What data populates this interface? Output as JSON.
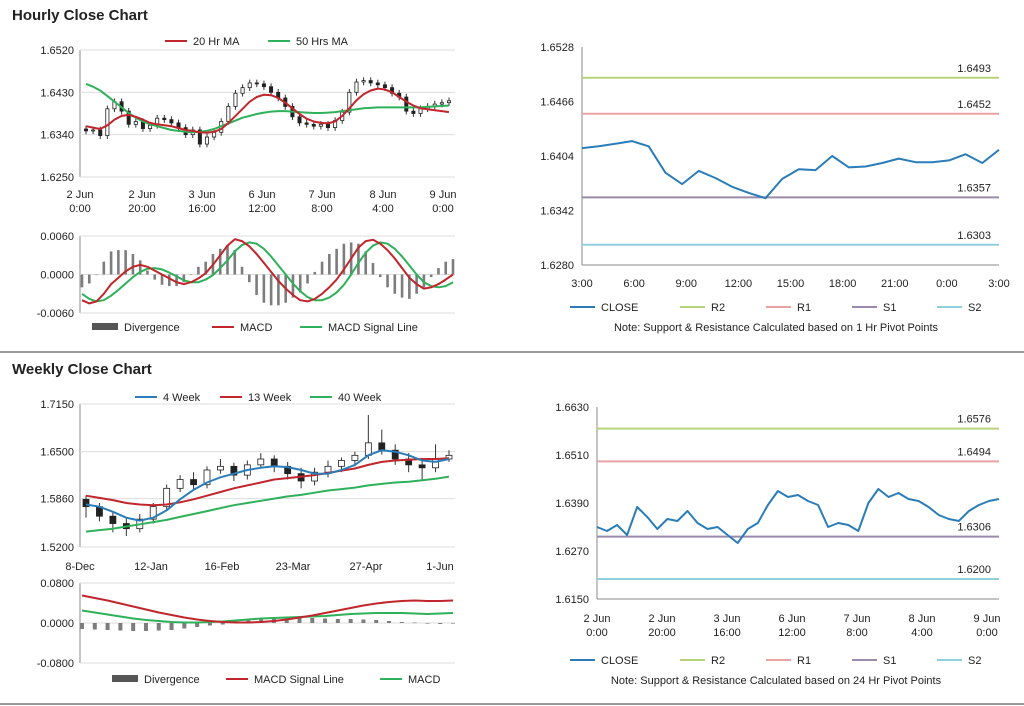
{
  "sections": {
    "hourly_title": "Hourly Close Chart",
    "weekly_title": "Weekly Close Chart"
  },
  "colors": {
    "blue": "#2a7db8",
    "red": "#c0262c",
    "green": "#2fb05a",
    "r2": "#b7d37a",
    "r1": "#e8a3a3",
    "s1": "#9a8aab",
    "s2": "#8fd0e0",
    "divergence": "#7d7d7d"
  },
  "chart_data": [
    {
      "id": "hourly-price",
      "type": "candlestick",
      "legend": [
        "20 Hr MA",
        "50 Hrs MA"
      ],
      "y_ticks": [
        "1.6520",
        "1.6430",
        "1.6340",
        "1.6250"
      ],
      "ylim": [
        1.625,
        1.652
      ],
      "x_ticks": [
        [
          "2 Jun",
          "0:00"
        ],
        [
          "2 Jun",
          "20:00"
        ],
        [
          "3 Jun",
          "16:00"
        ],
        [
          "6 Jun",
          "12:00"
        ],
        [
          "7 Jun",
          "8:00"
        ],
        [
          "8 Jun",
          "4:00"
        ],
        [
          "9 Jun",
          "0:00"
        ]
      ],
      "close": [
        1.6348,
        1.635,
        1.6338,
        1.6395,
        1.641,
        1.639,
        1.6362,
        1.6368,
        1.6353,
        1.636,
        1.6375,
        1.6372,
        1.6365,
        1.6355,
        1.634,
        1.635,
        1.632,
        1.6335,
        1.6345,
        1.6368,
        1.64,
        1.6428,
        1.644,
        1.645,
        1.6448,
        1.6442,
        1.643,
        1.6418,
        1.64,
        1.6378,
        1.6365,
        1.6362,
        1.6358,
        1.6362,
        1.6355,
        1.637,
        1.6388,
        1.643,
        1.6452,
        1.6455,
        1.645,
        1.6446,
        1.644,
        1.6428,
        1.642,
        1.639,
        1.6385,
        1.6395,
        1.64,
        1.6405,
        1.6408,
        1.6412
      ],
      "ma20": [
        1.6358,
        1.6355,
        1.6352,
        1.636,
        1.6372,
        1.638,
        1.6382,
        1.6378,
        1.6372,
        1.6365,
        1.6362,
        1.636,
        1.6358,
        1.6354,
        1.635,
        1.6348,
        1.6345,
        1.6344,
        1.6346,
        1.6352,
        1.6365,
        1.638,
        1.6395,
        1.641,
        1.642,
        1.6425,
        1.6424,
        1.6418,
        1.6408,
        1.6396,
        1.6384,
        1.6374,
        1.6368,
        1.6365,
        1.6364,
        1.6368,
        1.638,
        1.6396,
        1.6413,
        1.6426,
        1.6434,
        1.6438,
        1.6436,
        1.643,
        1.642,
        1.641,
        1.6402,
        1.6396,
        1.6394,
        1.6392,
        1.639,
        1.6388
      ],
      "ma50": [
        1.6448,
        1.6442,
        1.6434,
        1.6422,
        1.641,
        1.6398,
        1.6386,
        1.6376,
        1.6368,
        1.6362,
        1.6358,
        1.6354,
        1.635,
        1.6348,
        1.6346,
        1.6345,
        1.6346,
        1.6348,
        1.6352,
        1.6358,
        1.6364,
        1.637,
        1.6376,
        1.638,
        1.6384,
        1.6387,
        1.6389,
        1.639,
        1.639,
        1.6389,
        1.6388,
        1.6387,
        1.6386,
        1.6386,
        1.6387,
        1.6388,
        1.639,
        1.6392,
        1.6394,
        1.6396,
        1.6397,
        1.6398,
        1.6398,
        1.6398,
        1.6398,
        1.6398,
        1.6398,
        1.6398,
        1.6399,
        1.64,
        1.6401,
        1.6402
      ]
    },
    {
      "id": "hourly-macd",
      "type": "line+bar",
      "legend": [
        "Divergence",
        "MACD",
        "MACD Signal Line"
      ],
      "y_ticks": [
        "0.0060",
        "0.0000",
        "-0.0060"
      ],
      "ylim": [
        -0.006,
        0.006
      ],
      "macd": [
        -0.004,
        -0.0045,
        -0.0042,
        -0.003,
        -0.0015,
        -0.0005,
        0.0005,
        0.0012,
        0.0015,
        0.0012,
        0.0006,
        0.0,
        -0.0006,
        -0.0012,
        -0.0015,
        -0.0012,
        -0.0006,
        0.0002,
        0.0015,
        0.003,
        0.0045,
        0.0055,
        0.0052,
        0.0044,
        0.0032,
        0.0018,
        0.0004,
        -0.001,
        -0.0022,
        -0.0032,
        -0.004,
        -0.0042,
        -0.0038,
        -0.003,
        -0.002,
        -0.0008,
        0.0008,
        0.0025,
        0.0042,
        0.0052,
        0.0054,
        0.0048,
        0.0038,
        0.0025,
        0.001,
        -0.0005,
        -0.0015,
        -0.0022,
        -0.002,
        -0.0015,
        -0.0008,
        0.0
      ],
      "signal": [
        -0.003,
        -0.0038,
        -0.0042,
        -0.004,
        -0.0033,
        -0.0024,
        -0.0014,
        -0.0004,
        0.0004,
        0.0009,
        0.001,
        0.0008,
        0.0003,
        -0.0003,
        -0.0009,
        -0.0012,
        -0.0012,
        -0.0008,
        -0.0001,
        0.001,
        0.0022,
        0.0036,
        0.0046,
        0.005,
        0.0048,
        0.004,
        0.0028,
        0.0014,
        0.0,
        -0.0014,
        -0.0026,
        -0.0035,
        -0.004,
        -0.004,
        -0.0036,
        -0.0028,
        -0.0016,
        0.0,
        0.0018,
        0.0034,
        0.0045,
        0.005,
        0.0048,
        0.004,
        0.0028,
        0.0014,
        0.0,
        -0.0012,
        -0.0018,
        -0.002,
        -0.0018,
        -0.0012
      ]
    },
    {
      "id": "hourly-pivots",
      "type": "line",
      "legend": [
        "CLOSE",
        "R2",
        "R1",
        "S1",
        "S2"
      ],
      "y_ticks": [
        "1.6528",
        "1.6466",
        "1.6404",
        "1.6342",
        "1.6280"
      ],
      "ylim": [
        1.628,
        1.6528
      ],
      "x_ticks": [
        "3:00",
        "6:00",
        "9:00",
        "12:00",
        "15:00",
        "18:00",
        "21:00",
        "0:00",
        "3:00"
      ],
      "x_hours": [
        0,
        1,
        2,
        3,
        4,
        5,
        6,
        7,
        8,
        9,
        10,
        11,
        12,
        13,
        14,
        15,
        16,
        17,
        18,
        19,
        20,
        21,
        22,
        23,
        24
      ],
      "close": [
        1.6413,
        1.6415,
        1.6418,
        1.6421,
        1.6415,
        1.6385,
        1.6372,
        1.6387,
        1.6379,
        1.6369,
        1.6362,
        1.6356,
        1.6378,
        1.6389,
        1.6388,
        1.6404,
        1.6391,
        1.6392,
        1.6396,
        1.6401,
        1.6397,
        1.6397,
        1.6399,
        1.6406,
        1.6396,
        1.6411
      ],
      "levels": {
        "R2": 1.6493,
        "R1": 1.6452,
        "S1": 1.6357,
        "S2": 1.6303
      },
      "level_labels": {
        "R2": "1.6493",
        "R1": "1.6452",
        "S1": "1.6357",
        "S2": "1.6303"
      },
      "note": "Note: Support & Resistance Calculated based on 1 Hr Pivot Points"
    },
    {
      "id": "weekly-price",
      "type": "candlestick",
      "legend": [
        "4 Week",
        "13 Week",
        "40 Week"
      ],
      "y_ticks": [
        "1.7150",
        "1.6500",
        "1.5860",
        "1.5200"
      ],
      "ylim": [
        1.52,
        1.715
      ],
      "x_ticks": [
        "8-Dec",
        "12-Jan",
        "16-Feb",
        "23-Mar",
        "27-Apr",
        "1-Jun"
      ],
      "candles": [
        [
          1.585,
          1.575,
          1.59,
          1.56
        ],
        [
          1.575,
          1.562,
          1.58,
          1.555
        ],
        [
          1.562,
          1.552,
          1.568,
          1.54
        ],
        [
          1.552,
          1.545,
          1.56,
          1.535
        ],
        [
          1.545,
          1.558,
          1.565,
          1.54
        ],
        [
          1.558,
          1.575,
          1.58,
          1.552
        ],
        [
          1.575,
          1.6,
          1.605,
          1.57
        ],
        [
          1.6,
          1.612,
          1.618,
          1.595
        ],
        [
          1.612,
          1.605,
          1.622,
          1.598
        ],
        [
          1.605,
          1.625,
          1.63,
          1.6
        ],
        [
          1.625,
          1.63,
          1.64,
          1.62
        ],
        [
          1.63,
          1.618,
          1.635,
          1.61
        ],
        [
          1.618,
          1.632,
          1.638,
          1.612
        ],
        [
          1.632,
          1.64,
          1.648,
          1.628
        ],
        [
          1.64,
          1.63,
          1.645,
          1.622
        ],
        [
          1.63,
          1.62,
          1.636,
          1.612
        ],
        [
          1.62,
          1.61,
          1.628,
          1.6
        ],
        [
          1.61,
          1.622,
          1.628,
          1.604
        ],
        [
          1.622,
          1.63,
          1.638,
          1.615
        ],
        [
          1.63,
          1.638,
          1.642,
          1.622
        ],
        [
          1.638,
          1.645,
          1.65,
          1.63
        ],
        [
          1.645,
          1.662,
          1.7,
          1.64
        ],
        [
          1.662,
          1.652,
          1.68,
          1.646
        ],
        [
          1.652,
          1.64,
          1.66,
          1.632
        ],
        [
          1.64,
          1.632,
          1.648,
          1.622
        ],
        [
          1.632,
          1.628,
          1.64,
          1.612
        ],
        [
          1.628,
          1.64,
          1.66,
          1.622
        ],
        [
          1.64,
          1.645,
          1.652,
          1.636
        ]
      ],
      "ma4": [
        1.578,
        1.575,
        1.568,
        1.56,
        1.556,
        1.56,
        1.57,
        1.585,
        1.598,
        1.608,
        1.615,
        1.62,
        1.625,
        1.628,
        1.63,
        1.629,
        1.625,
        1.62,
        1.62,
        1.625,
        1.632,
        1.645,
        1.652,
        1.65,
        1.645,
        1.638,
        1.636,
        1.64
      ],
      "ma13": [
        1.59,
        1.587,
        1.584,
        1.58,
        1.578,
        1.577,
        1.578,
        1.581,
        1.585,
        1.59,
        1.595,
        1.6,
        1.604,
        1.608,
        1.612,
        1.614,
        1.616,
        1.618,
        1.621,
        1.624,
        1.627,
        1.632,
        1.636,
        1.638,
        1.639,
        1.64,
        1.64,
        1.641
      ],
      "ma40": [
        1.541,
        1.543,
        1.545,
        1.548,
        1.551,
        1.554,
        1.557,
        1.561,
        1.565,
        1.569,
        1.573,
        1.577,
        1.58,
        1.583,
        1.586,
        1.589,
        1.591,
        1.594,
        1.597,
        1.599,
        1.601,
        1.604,
        1.606,
        1.608,
        1.609,
        1.611,
        1.613,
        1.616
      ]
    },
    {
      "id": "weekly-macd",
      "type": "line+bar",
      "legend": [
        "Divergence",
        "MACD Signal Line",
        "MACD"
      ],
      "y_ticks": [
        "0.0800",
        "0.0000",
        "-0.0800"
      ],
      "ylim": [
        -0.08,
        0.08
      ],
      "signal": [
        0.055,
        0.05,
        0.045,
        0.039,
        0.033,
        0.027,
        0.021,
        0.016,
        0.011,
        0.007,
        0.004,
        0.002,
        0.001,
        0.001,
        0.002,
        0.004,
        0.007,
        0.011,
        0.015,
        0.02,
        0.025,
        0.03,
        0.035,
        0.039,
        0.042,
        0.044,
        0.045,
        0.044,
        0.044,
        0.045
      ],
      "macd": [
        0.025,
        0.021,
        0.017,
        0.013,
        0.009,
        0.006,
        0.004,
        0.002,
        0.001,
        0.001,
        0.002,
        0.003,
        0.005,
        0.007,
        0.009,
        0.01,
        0.011,
        0.012,
        0.013,
        0.014,
        0.016,
        0.018,
        0.019,
        0.02,
        0.02,
        0.02,
        0.019,
        0.018,
        0.019,
        0.02
      ],
      "divergence": [
        -0.012,
        -0.013,
        -0.014,
        -0.015,
        -0.016,
        -0.016,
        -0.015,
        -0.014,
        -0.011,
        -0.008,
        -0.005,
        -0.003,
        0.002,
        0.005,
        0.007,
        0.009,
        0.01,
        0.011,
        0.01,
        0.009,
        0.008,
        0.008,
        0.007,
        0.006,
        0.004,
        0.002,
        0.001,
        -0.001,
        -0.002,
        -0.001
      ]
    },
    {
      "id": "daily-pivots",
      "type": "line",
      "legend": [
        "CLOSE",
        "R2",
        "R1",
        "S1",
        "S2"
      ],
      "y_ticks": [
        "1.6630",
        "1.6510",
        "1.6390",
        "1.6270",
        "1.6150"
      ],
      "ylim": [
        1.615,
        1.663
      ],
      "x_ticks": [
        [
          "2 Jun",
          "0:00"
        ],
        [
          "2 Jun",
          "20:00"
        ],
        [
          "3 Jun",
          "16:00"
        ],
        [
          "6 Jun",
          "12:00"
        ],
        [
          "7 Jun",
          "8:00"
        ],
        [
          "8 Jun",
          "4:00"
        ],
        [
          "9 Jun",
          "0:00"
        ]
      ],
      "close": [
        1.633,
        1.632,
        1.6335,
        1.631,
        1.638,
        1.6355,
        1.6325,
        1.635,
        1.6345,
        1.637,
        1.634,
        1.6325,
        1.633,
        1.631,
        1.629,
        1.6325,
        1.634,
        1.6385,
        1.642,
        1.6405,
        1.641,
        1.6395,
        1.6385,
        1.633,
        1.634,
        1.6335,
        1.632,
        1.639,
        1.6425,
        1.6405,
        1.6415,
        1.64,
        1.6395,
        1.638,
        1.636,
        1.635,
        1.6345,
        1.637,
        1.6385,
        1.6395,
        1.64
      ],
      "levels": {
        "R2": 1.6576,
        "R1": 1.6494,
        "S1": 1.6306,
        "S2": 1.62
      },
      "level_labels": {
        "R2": "1.6576",
        "R1": "1.6494",
        "S1": "1.6306",
        "S2": "1.6200"
      },
      "note": "Note: Support & Resistance Calculated based on 24 Hr Pivot Points"
    }
  ]
}
